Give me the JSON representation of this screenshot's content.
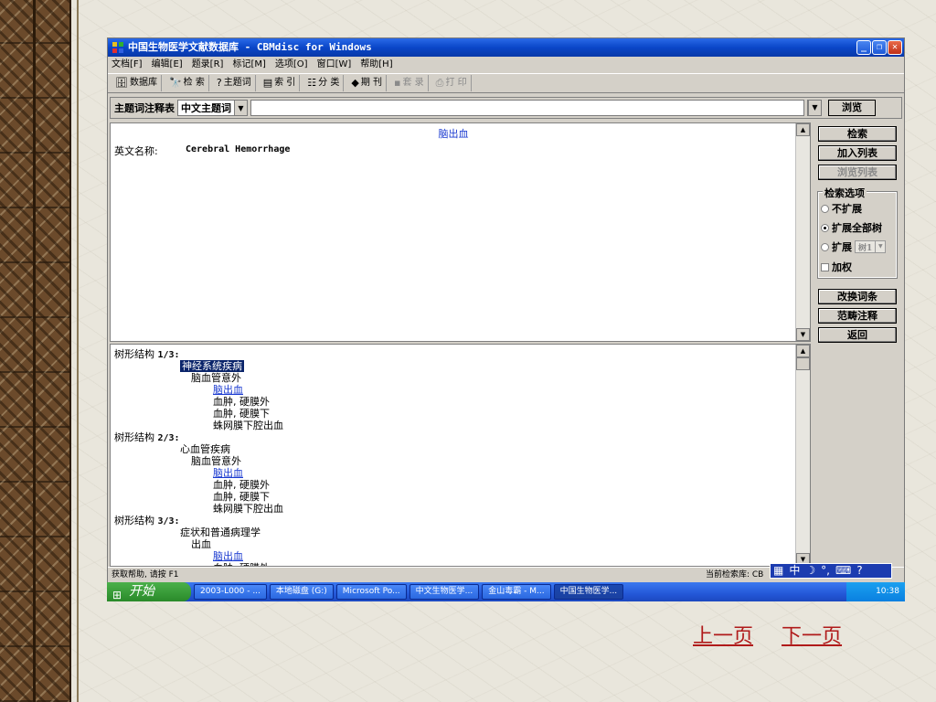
{
  "window": {
    "title": "中国生物医学文献数据库 - CBMdisc for Windows",
    "menu": [
      "文档[F]",
      "编辑[E]",
      "题录[R]",
      "标记[M]",
      "选项[O]",
      "窗口[W]",
      "帮助[H]"
    ],
    "toolbar": [
      {
        "label": "数据库",
        "icon": "database-icon"
      },
      {
        "label": "检 索",
        "icon": "binoculars-icon"
      },
      {
        "label": "主题词",
        "icon": "subject-icon"
      },
      {
        "label": "索 引",
        "icon": "index-icon"
      },
      {
        "label": "分 类",
        "icon": "classify-icon"
      },
      {
        "label": "期 刊",
        "icon": "journal-icon"
      },
      {
        "label": "套 录",
        "icon": "save-icon"
      },
      {
        "label": "打 印",
        "icon": "print-icon"
      }
    ]
  },
  "search": {
    "label": "主题词注释表",
    "type_value": "中文主题词",
    "input_value": "",
    "browse_label": "浏览"
  },
  "detail": {
    "heading": "脑出血",
    "eng_label": "英文名称:",
    "eng_value": "Cerebral Hemorrhage"
  },
  "tree": {
    "sections": [
      {
        "header": "树形结构",
        "num": "1/3:",
        "lines": [
          {
            "text": "神经系统疾病",
            "level": 1,
            "style": "sel"
          },
          {
            "text": "脑血管意外",
            "level": 2
          },
          {
            "text": "脑出血",
            "level": 3,
            "style": "link"
          },
          {
            "text": "血肿, 硬膜外",
            "level": 4
          },
          {
            "text": "血肿, 硬膜下",
            "level": 4
          },
          {
            "text": "蛛网膜下腔出血",
            "level": 4
          }
        ]
      },
      {
        "header": "树形结构",
        "num": "2/3:",
        "lines": [
          {
            "text": "心血管疾病",
            "level": 1
          },
          {
            "text": "脑血管意外",
            "level": 2
          },
          {
            "text": "脑出血",
            "level": 3,
            "style": "link"
          },
          {
            "text": "血肿, 硬膜外",
            "level": 4
          },
          {
            "text": "血肿, 硬膜下",
            "level": 4
          },
          {
            "text": "蛛网膜下腔出血",
            "level": 4
          }
        ]
      },
      {
        "header": "树形结构",
        "num": "3/3:",
        "lines": [
          {
            "text": "症状和普通病理学",
            "level": 1
          },
          {
            "text": "出血",
            "level": 2
          },
          {
            "text": "脑出血",
            "level": 3,
            "style": "link"
          },
          {
            "text": "血肿, 硬膜外",
            "level": 4
          }
        ]
      }
    ]
  },
  "side": {
    "search_btn": "检索",
    "add_list_btn": "加入列表",
    "browse_list_btn": "浏览列表",
    "options_title": "检索选项",
    "opt_no_expand": "不扩展",
    "opt_expand_all": "扩展全部树",
    "opt_expand": "扩展",
    "opt_tree_value": "树1",
    "opt_weighted": "加权",
    "change_btn": "改换词条",
    "scope_btn": "范畴注释",
    "back_btn": "返回"
  },
  "status": {
    "help": "获取帮助, 请按 F1",
    "db": "当前检索库: CB"
  },
  "ime": {
    "mode": "中"
  },
  "taskbar": {
    "start": "开始",
    "tasks": [
      "2003-L000 - ...",
      "本地磁盘 (G:)",
      "Microsoft Po...",
      "中文生物医学...",
      "金山毒霸 - M...",
      "中国生物医学..."
    ],
    "clock": "10:38"
  },
  "nav": {
    "prev": "上一页",
    "next": "下一页"
  },
  "colors": {
    "link": "#1a3ad0",
    "selection": "#0a246a",
    "nav": "#b01a1a"
  }
}
